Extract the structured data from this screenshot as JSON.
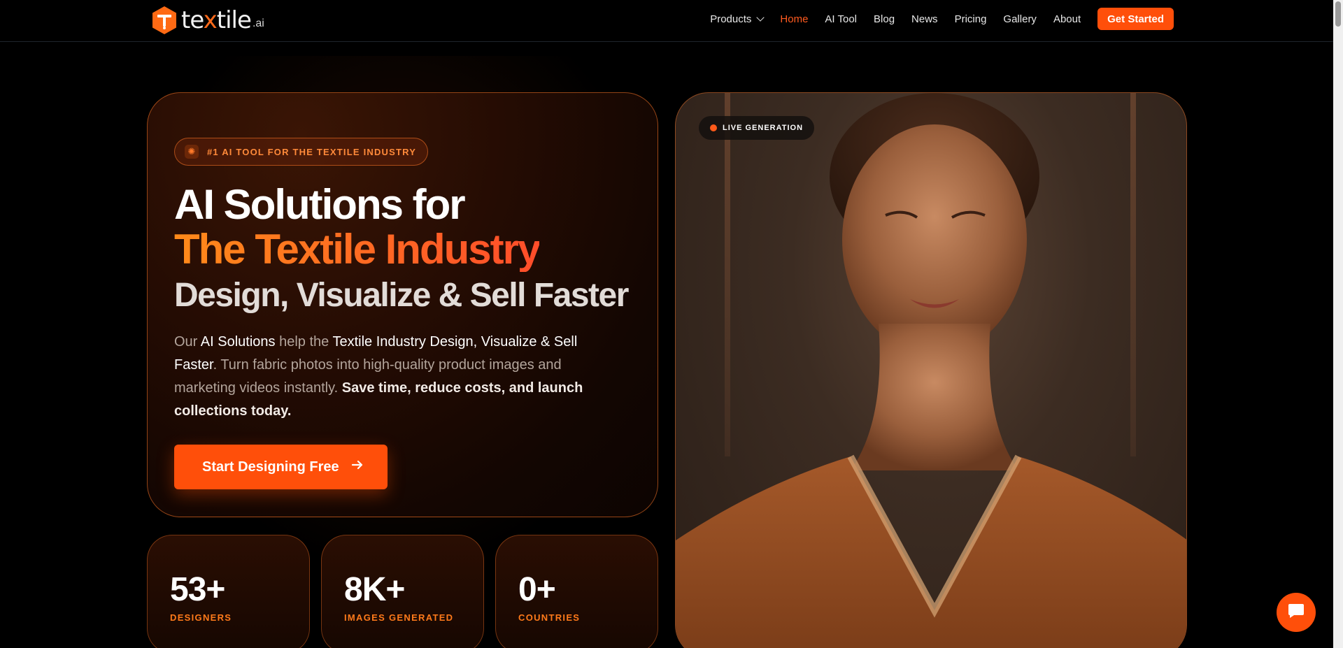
{
  "brand": {
    "name_pre": "te",
    "name_x": "x",
    "name_post": "tile",
    "suffix": ".ai"
  },
  "nav": {
    "items": [
      {
        "label": "Products",
        "has_dropdown": true
      },
      {
        "label": "Home",
        "active": true
      },
      {
        "label": "AI Tool"
      },
      {
        "label": "Blog"
      },
      {
        "label": "News"
      },
      {
        "label": "Pricing"
      },
      {
        "label": "Gallery"
      },
      {
        "label": "About"
      }
    ],
    "cta": "Get Started"
  },
  "hero": {
    "badge": "#1 AI TOOL FOR THE TEXTILE INDUSTRY",
    "title_line1": "AI Solutions for",
    "title_line2": "The Textile Industry",
    "subtitle": "Design, Visualize & Sell Faster",
    "desc": {
      "p1": "Our ",
      "b1": "AI Solutions",
      "p2": " help the ",
      "b2": "Textile Industry Design, Visualize & Sell Faster",
      "p3": ". Turn fabric photos into high-quality product images and marketing videos instantly. ",
      "b3": "Save time, reduce costs, and launch collections today."
    },
    "cta": "Start Designing Free",
    "cta_icon": "arrow-right-icon"
  },
  "stats": [
    {
      "value": "53+",
      "label": "DESIGNERS"
    },
    {
      "value": "8K+",
      "label": "IMAGES GENERATED"
    },
    {
      "value": "0+",
      "label": "COUNTRIES"
    }
  ],
  "showcase": {
    "badge": "LIVE GENERATION"
  },
  "colors": {
    "accent": "#ff4f0a",
    "accent_light": "#ff7a1a",
    "background": "#000000"
  },
  "chat": {
    "icon": "chat-bubble-icon"
  }
}
